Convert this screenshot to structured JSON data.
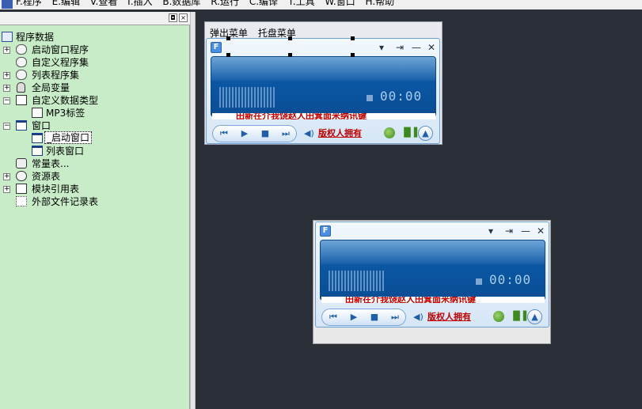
{
  "menubar": {
    "items": [
      {
        "label": "F.程序"
      },
      {
        "label": "E.编辑"
      },
      {
        "label": "V.查看"
      },
      {
        "label": "I.插入"
      },
      {
        "label": "B.数据库"
      },
      {
        "label": "R.运行"
      },
      {
        "label": "C.编译"
      },
      {
        "label": "T.工具"
      },
      {
        "label": "W.窗口"
      },
      {
        "label": "H.帮助"
      }
    ]
  },
  "panel": {
    "pin_glyph": "◘",
    "close_glyph": "×"
  },
  "tree": {
    "items": [
      {
        "label": "程序数据",
        "icon": "program-data-icon"
      },
      {
        "label": "启动窗口程序",
        "icon": "module-icon"
      },
      {
        "label": "自定义程序集",
        "icon": "module-icon"
      },
      {
        "label": "列表程序集",
        "icon": "module-icon"
      },
      {
        "label": "全局变量",
        "icon": "variable-icon"
      },
      {
        "label": "自定义数据类型",
        "icon": "datatype-icon"
      },
      {
        "label": "MP3标签",
        "icon": "datatype-icon"
      },
      {
        "label": "窗口",
        "icon": "window-icon"
      },
      {
        "label": "_启动窗口",
        "icon": "window-icon",
        "selected": true
      },
      {
        "label": "列表窗口",
        "icon": "window-icon"
      },
      {
        "label": "常量表...",
        "icon": "constant-icon"
      },
      {
        "label": "资源表",
        "icon": "resource-icon"
      },
      {
        "label": "模块引用表",
        "icon": "module-ref-icon"
      },
      {
        "label": "外部文件记录表",
        "icon": "external-file-icon"
      }
    ]
  },
  "designer": {
    "menus": [
      "弹出菜单",
      "托盘菜单"
    ]
  },
  "player": {
    "logo": "F",
    "title_buttons": {
      "menu": "▾",
      "pin": "⇥",
      "minimize": "—",
      "close": "✕"
    },
    "time": "00:00",
    "marquee": "田新在介我饶赵人田箕面米纳讯键",
    "copyright_text": "版权人拥有",
    "transport": {
      "prev": "⏮",
      "play": "▶",
      "stop": "■",
      "next": "⏭"
    },
    "volume_glyph": "◀)",
    "eq_glyph": "▐▌▌",
    "up_glyph": "▲"
  },
  "colors": {
    "workspace_bg": "#2b2f38",
    "panel_bg": "#c8ebc8",
    "player_screen": "#0b57a3",
    "marquee_text": "#c00000"
  }
}
